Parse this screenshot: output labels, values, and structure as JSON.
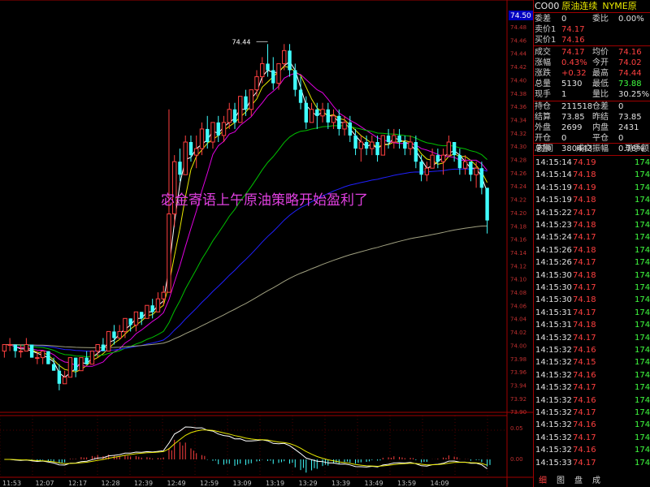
{
  "header": {
    "symbol": "CO00",
    "name": "原油连续",
    "exchange": "NYME原"
  },
  "quote": {
    "rows": [
      {
        "l1": "委差",
        "v1": "0",
        "c1": "white",
        "l2": "委比",
        "v2": "0.00%",
        "c2": "white"
      },
      {
        "l1": "卖价1",
        "v1": "74.17",
        "c1": "red",
        "l2": "",
        "v2": "",
        "c2": "white"
      },
      {
        "l1": "买价1",
        "v1": "74.16",
        "c1": "red",
        "l2": "",
        "v2": "",
        "c2": "white"
      },
      {
        "l1": "成交",
        "v1": "74.17",
        "c1": "red",
        "l2": "均价",
        "v2": "74.16",
        "c2": "red"
      },
      {
        "l1": "涨幅",
        "v1": "0.43%",
        "c1": "red",
        "l2": "今开",
        "v2": "74.02",
        "c2": "red"
      },
      {
        "l1": "涨跌",
        "v1": "+0.32",
        "c1": "red",
        "l2": "最高",
        "v2": "74.44",
        "c2": "red"
      },
      {
        "l1": "总量",
        "v1": "5130",
        "c1": "white",
        "l2": "最低",
        "v2": "73.88",
        "c2": "green"
      },
      {
        "l1": "现手",
        "v1": "1",
        "c1": "white",
        "l2": "量比",
        "v2": "30.25%",
        "c2": "white"
      },
      {
        "l1": "持仓",
        "v1": "211518",
        "c1": "white",
        "l2": "仓差",
        "v2": "0",
        "c2": "white"
      },
      {
        "l1": "结算",
        "v1": "73.85",
        "c1": "white",
        "l2": "昨结",
        "v2": "73.85",
        "c2": "white"
      },
      {
        "l1": "外盘",
        "v1": "2699",
        "c1": "white",
        "l2": "内盘",
        "v2": "2431",
        "c2": "white"
      },
      {
        "l1": "开仓",
        "v1": "0",
        "c1": "white",
        "l2": "平仓",
        "v2": "0",
        "c2": "white"
      },
      {
        "l1": "总额",
        "v1": "380443",
        "c1": "white",
        "l2": "振幅",
        "v2": "0.76%",
        "c2": "white"
      }
    ]
  },
  "ticks_header": {
    "time": "时间",
    "price": "成交",
    "volume": "现手额"
  },
  "ticks": [
    {
      "t": "14:15:14",
      "p": "74.19",
      "c": "red",
      "v": "174"
    },
    {
      "t": "14:15:14",
      "p": "74.18",
      "c": "red",
      "v": "174"
    },
    {
      "t": "14:15:19",
      "p": "74.19",
      "c": "red",
      "v": "174"
    },
    {
      "t": "14:15:19",
      "p": "74.18",
      "c": "red",
      "v": "174"
    },
    {
      "t": "14:15:22",
      "p": "74.17",
      "c": "red",
      "v": "174"
    },
    {
      "t": "14:15:23",
      "p": "74.18",
      "c": "red",
      "v": "174"
    },
    {
      "t": "14:15:24",
      "p": "74.17",
      "c": "red",
      "v": "174"
    },
    {
      "t": "14:15:26",
      "p": "74.18",
      "c": "red",
      "v": "174"
    },
    {
      "t": "14:15:26",
      "p": "74.17",
      "c": "red",
      "v": "174"
    },
    {
      "t": "14:15:30",
      "p": "74.18",
      "c": "red",
      "v": "174"
    },
    {
      "t": "14:15:30",
      "p": "74.17",
      "c": "red",
      "v": "174"
    },
    {
      "t": "14:15:30",
      "p": "74.18",
      "c": "red",
      "v": "174"
    },
    {
      "t": "14:15:31",
      "p": "74.17",
      "c": "red",
      "v": "174"
    },
    {
      "t": "14:15:31",
      "p": "74.18",
      "c": "red",
      "v": "174"
    },
    {
      "t": "14:15:32",
      "p": "74.17",
      "c": "red",
      "v": "174"
    },
    {
      "t": "14:15:32",
      "p": "74.16",
      "c": "red",
      "v": "174"
    },
    {
      "t": "14:15:32",
      "p": "74.15",
      "c": "red",
      "v": "174"
    },
    {
      "t": "14:15:32",
      "p": "74.16",
      "c": "red",
      "v": "174"
    },
    {
      "t": "14:15:32",
      "p": "74.17",
      "c": "red",
      "v": "174"
    },
    {
      "t": "14:15:32",
      "p": "74.16",
      "c": "red",
      "v": "174"
    },
    {
      "t": "14:15:32",
      "p": "74.17",
      "c": "red",
      "v": "174"
    },
    {
      "t": "14:15:32",
      "p": "74.16",
      "c": "red",
      "v": "174"
    },
    {
      "t": "14:15:32",
      "p": "74.17",
      "c": "red",
      "v": "174"
    },
    {
      "t": "14:15:32",
      "p": "74.16",
      "c": "red",
      "v": "174"
    },
    {
      "t": "14:15:33",
      "p": "74.17",
      "c": "red",
      "v": "174"
    }
  ],
  "bottom_tabs": [
    "细",
    "图",
    "盘",
    "成"
  ],
  "overlay_text": "宓金寄语上午原油策略开始盈利了",
  "chart": {
    "current_price_tag": "74.50",
    "high_label": "74.44",
    "price_axis_labels": [
      "74.48",
      "74.46",
      "74.44",
      "74.42",
      "74.40",
      "74.38",
      "74.36",
      "74.34",
      "74.32",
      "74.30",
      "74.28",
      "74.26",
      "74.24",
      "74.22",
      "74.20",
      "74.18",
      "74.16",
      "74.14",
      "74.12",
      "74.10",
      "74.08",
      "74.06",
      "74.04",
      "74.02",
      "74.00",
      "73.98",
      "73.96",
      "73.94",
      "73.92",
      "73.90"
    ],
    "macd_axis_labels": [
      "0.05",
      "0.00"
    ],
    "time_labels": [
      "11:53",
      "12:07",
      "12:17",
      "12:28",
      "12:39",
      "12:49",
      "12:59",
      "13:09",
      "13:19",
      "13:29",
      "13:39",
      "13:49",
      "13:59",
      "14:09"
    ],
    "colors": {
      "up": "#ff4040",
      "down": "#40ffff",
      "grid": "#a00000",
      "ma5": "#ffffff",
      "ma10": "#e8e800",
      "ma20": "#e000e0",
      "ma60": "#00c000",
      "ma120": "#2020ff",
      "ma250": "#a0a080"
    }
  },
  "chart_data": {
    "type": "candlestick",
    "ylim": [
      73.88,
      74.5
    ],
    "candles": [
      [
        73.97,
        73.98,
        73.96,
        73.98
      ],
      [
        73.98,
        73.99,
        73.97,
        73.98
      ],
      [
        73.98,
        73.98,
        73.96,
        73.97
      ],
      [
        73.97,
        73.98,
        73.96,
        73.97
      ],
      [
        73.97,
        73.99,
        73.97,
        73.98
      ],
      [
        73.98,
        73.98,
        73.96,
        73.96
      ],
      [
        73.96,
        73.97,
        73.95,
        73.96
      ],
      [
        73.96,
        73.97,
        73.95,
        73.97
      ],
      [
        73.97,
        73.97,
        73.95,
        73.95
      ],
      [
        73.95,
        73.96,
        73.94,
        73.94
      ],
      [
        73.94,
        73.95,
        73.91,
        73.92
      ],
      [
        73.92,
        73.94,
        73.92,
        73.93
      ],
      [
        73.93,
        73.96,
        73.93,
        73.96
      ],
      [
        73.96,
        73.96,
        73.93,
        73.94
      ],
      [
        73.94,
        73.96,
        73.94,
        73.96
      ],
      [
        73.96,
        73.97,
        73.95,
        73.95
      ],
      [
        73.95,
        73.97,
        73.95,
        73.97
      ],
      [
        73.97,
        73.98,
        73.96,
        73.98
      ],
      [
        73.98,
        73.99,
        73.97,
        73.97
      ],
      [
        73.97,
        74.0,
        73.97,
        74.0
      ],
      [
        74.0,
        74.01,
        73.98,
        73.99
      ],
      [
        73.99,
        74.01,
        73.99,
        74.0
      ],
      [
        74.0,
        74.02,
        73.99,
        74.02
      ],
      [
        74.02,
        74.02,
        74.0,
        74.01
      ],
      [
        74.01,
        74.03,
        74.0,
        74.03
      ],
      [
        74.03,
        74.03,
        74.01,
        74.02
      ],
      [
        74.02,
        74.04,
        74.02,
        74.04
      ],
      [
        74.04,
        74.05,
        74.02,
        74.03
      ],
      [
        74.03,
        74.06,
        74.03,
        74.05
      ],
      [
        74.05,
        74.07,
        74.04,
        74.06
      ],
      [
        74.06,
        74.34,
        74.06,
        74.18
      ],
      [
        74.18,
        74.27,
        74.16,
        74.26
      ],
      [
        74.26,
        74.28,
        74.23,
        74.24
      ],
      [
        74.24,
        74.3,
        74.24,
        74.29
      ],
      [
        74.29,
        74.3,
        74.26,
        74.27
      ],
      [
        74.27,
        74.3,
        74.25,
        74.28
      ],
      [
        74.28,
        74.32,
        74.27,
        74.31
      ],
      [
        74.31,
        74.33,
        74.28,
        74.29
      ],
      [
        74.29,
        74.32,
        74.28,
        74.32
      ],
      [
        74.32,
        74.33,
        74.29,
        74.3
      ],
      [
        74.3,
        74.33,
        74.29,
        74.32
      ],
      [
        74.32,
        74.35,
        74.31,
        74.34
      ],
      [
        74.34,
        74.35,
        74.31,
        74.32
      ],
      [
        74.32,
        74.36,
        74.32,
        74.36
      ],
      [
        74.36,
        74.37,
        74.33,
        74.34
      ],
      [
        74.34,
        74.37,
        74.33,
        74.37
      ],
      [
        74.37,
        74.4,
        74.36,
        74.39
      ],
      [
        74.39,
        74.42,
        74.38,
        74.41
      ],
      [
        74.41,
        74.44,
        74.39,
        74.4
      ],
      [
        74.4,
        74.42,
        74.37,
        74.38
      ],
      [
        74.38,
        74.41,
        74.37,
        74.41
      ],
      [
        74.41,
        74.44,
        74.4,
        74.43
      ],
      [
        74.43,
        74.44,
        74.39,
        74.4
      ],
      [
        74.4,
        74.41,
        74.36,
        74.37
      ],
      [
        74.37,
        74.39,
        74.34,
        74.35
      ],
      [
        74.35,
        74.36,
        74.31,
        74.32
      ],
      [
        74.32,
        74.35,
        74.32,
        74.34
      ],
      [
        74.34,
        74.35,
        74.31,
        74.33
      ],
      [
        74.33,
        74.35,
        74.32,
        74.34
      ],
      [
        74.34,
        74.35,
        74.31,
        74.32
      ],
      [
        74.32,
        74.34,
        74.31,
        74.33
      ],
      [
        74.33,
        74.34,
        74.3,
        74.31
      ],
      [
        74.31,
        74.33,
        74.3,
        74.32
      ],
      [
        74.32,
        74.33,
        74.29,
        74.3
      ],
      [
        74.3,
        74.31,
        74.27,
        74.28
      ],
      [
        74.28,
        74.3,
        74.26,
        74.29
      ],
      [
        74.29,
        74.3,
        74.27,
        74.28
      ],
      [
        74.28,
        74.3,
        74.27,
        74.29
      ],
      [
        74.29,
        74.3,
        74.26,
        74.27
      ],
      [
        74.27,
        74.3,
        74.27,
        74.3
      ],
      [
        74.3,
        74.31,
        74.28,
        74.29
      ],
      [
        74.29,
        74.31,
        74.28,
        74.3
      ],
      [
        74.3,
        74.31,
        74.28,
        74.29
      ],
      [
        74.29,
        74.3,
        74.27,
        74.28
      ],
      [
        74.28,
        74.3,
        74.27,
        74.29
      ],
      [
        74.29,
        74.3,
        74.25,
        74.26
      ],
      [
        74.26,
        74.27,
        74.23,
        74.24
      ],
      [
        74.24,
        74.26,
        74.23,
        74.25
      ],
      [
        74.25,
        74.28,
        74.25,
        74.27
      ],
      [
        74.27,
        74.28,
        74.25,
        74.26
      ],
      [
        74.26,
        74.28,
        74.24,
        74.27
      ],
      [
        74.27,
        74.3,
        74.27,
        74.29
      ],
      [
        74.29,
        74.29,
        74.26,
        74.27
      ],
      [
        74.27,
        74.28,
        74.24,
        74.25
      ],
      [
        74.25,
        74.27,
        74.24,
        74.26
      ],
      [
        74.26,
        74.26,
        74.23,
        74.24
      ],
      [
        74.24,
        74.26,
        74.22,
        74.25
      ],
      [
        74.25,
        74.26,
        74.21,
        74.22
      ],
      [
        74.22,
        74.18,
        74.15,
        74.17
      ]
    ],
    "ma_series": [
      {
        "name": "ma5"
      },
      {
        "name": "ma10"
      },
      {
        "name": "ma20"
      },
      {
        "name": "ma60"
      },
      {
        "name": "ma120"
      },
      {
        "name": "ma250"
      }
    ]
  }
}
